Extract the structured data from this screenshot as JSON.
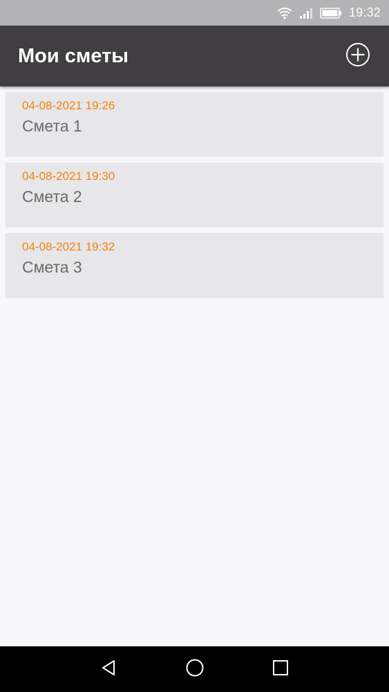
{
  "status_bar": {
    "time": "19:32",
    "icons": [
      "wifi-icon",
      "signal-icon",
      "battery-icon"
    ]
  },
  "app_bar": {
    "title": "Мои сметы",
    "add_icon": "plus-circle-icon"
  },
  "estimates": [
    {
      "date": "04-08-2021 19:26",
      "name": "Смета 1"
    },
    {
      "date": "04-08-2021 19:30",
      "name": "Смета 2"
    },
    {
      "date": "04-08-2021 19:32",
      "name": "Смета 3"
    }
  ],
  "nav_bar": {
    "icons": [
      "back-icon",
      "home-icon",
      "recents-icon"
    ]
  },
  "colors": {
    "status_bar": "#b3b2b4",
    "app_bar": "#403e40",
    "date_accent": "#f0830e",
    "item_background": "#e7e6e8",
    "page_background": "#f8f7f9"
  }
}
